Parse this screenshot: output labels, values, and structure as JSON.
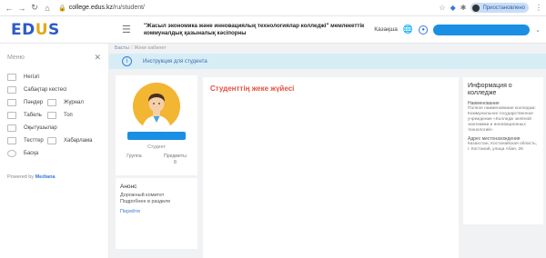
{
  "browser": {
    "url_host": "college.edus.kz",
    "url_path": "/ru/student/",
    "profile_label": "Приостановлено"
  },
  "header": {
    "logo_main": "ED",
    "logo_accent": "U",
    "logo_tail": "S",
    "college_name": "\"Жасыл экономика және инновациялық технологиялар колледжі\" мемлекеттік коммуналдық қазыналық кәсіпорны",
    "language": "Казақша"
  },
  "sidebar": {
    "title": "Меню",
    "items": [
      {
        "label": "Негізгі"
      },
      {
        "label": "Сабақтар кестесі"
      },
      {
        "label": "Пәндер",
        "label2": "Журнал"
      },
      {
        "label": "Табель",
        "label2": "Топ"
      },
      {
        "label": "Оқытушылар"
      },
      {
        "label": "Тесттер",
        "label2": "Хабарлама"
      },
      {
        "label": "Басқа"
      }
    ],
    "powered_prefix": "Powered by",
    "powered_brand": "Mediana"
  },
  "content": {
    "breadcrumb_home": "Басты",
    "breadcrumb_current": "Жеке кабинет",
    "info_text": "Инструкция для студента",
    "main_title": "Студенттің жеке жүйесі",
    "profile": {
      "subtitle": "Студент",
      "col1": "Группа",
      "col2": "Предметы",
      "col2_value": "8"
    },
    "news": {
      "title": "Анонс",
      "line1": "Дорожный комитет",
      "line2": "Подробнее в разделе",
      "link": "Перейти"
    },
    "right": {
      "title": "Информация о колледже",
      "label1": "Наименование",
      "text1": "Полное наименование колледжа: Коммунальное государственное учреждение «Колледж зелёной экономики и инновационных технологий»",
      "label2": "Адрес местонахождения",
      "text2": "Казахстан, Костанайская область, г. Костанай, улица Абая, 28"
    }
  }
}
